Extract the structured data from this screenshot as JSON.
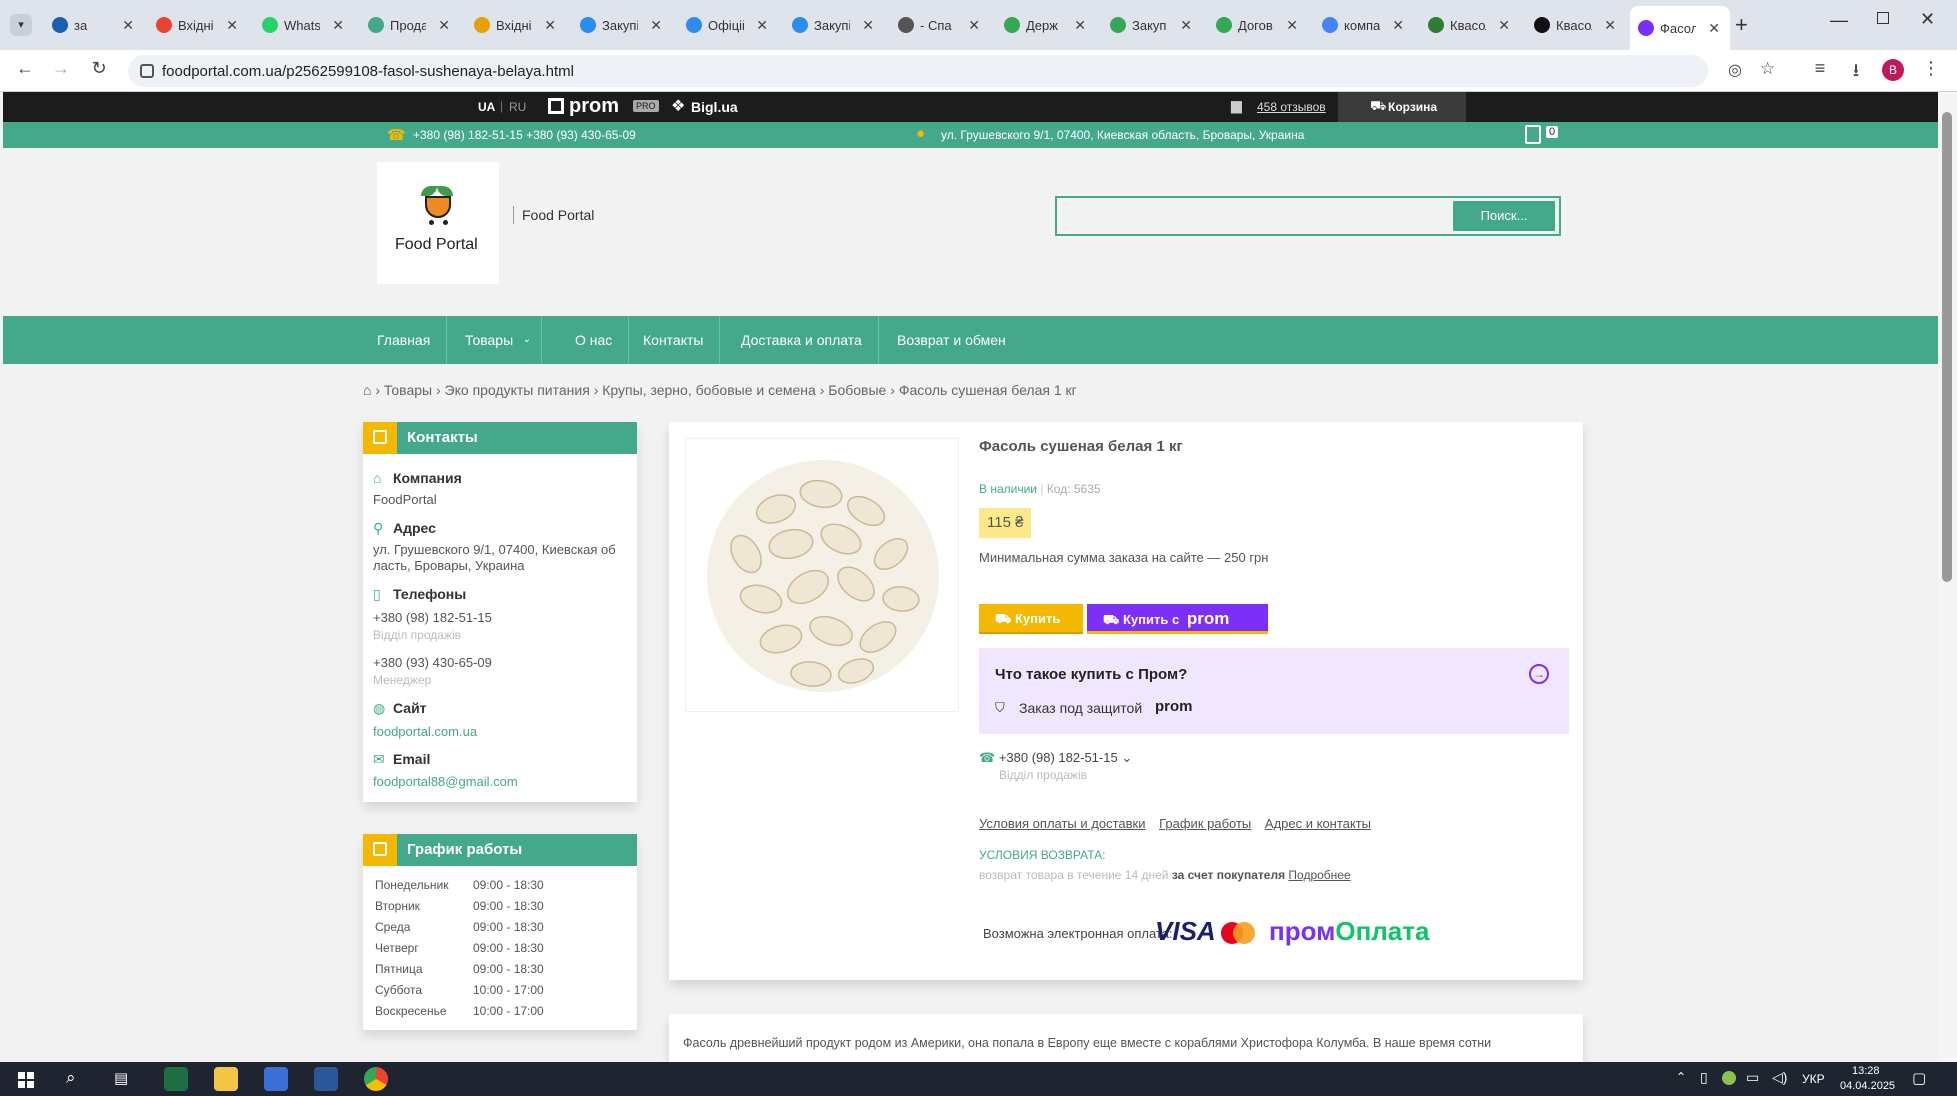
{
  "browser": {
    "tabs": [
      {
        "title": "за",
        "color": "#1a5fb4"
      },
      {
        "title": "Вхідні",
        "color": "#ea4335"
      },
      {
        "title": "WhatsApp",
        "color": "#25d366"
      },
      {
        "title": "Продаж",
        "color": "#44a98b"
      },
      {
        "title": "Вхідні",
        "color": "#e6a000"
      },
      {
        "title": "Закупівлі",
        "color": "#2d8cf0"
      },
      {
        "title": "Офіційно",
        "color": "#2d8cf0"
      },
      {
        "title": "Закупівлі",
        "color": "#2d8cf0"
      },
      {
        "title": "- Спа",
        "color": "#555"
      },
      {
        "title": "Держ",
        "color": "#34a853"
      },
      {
        "title": "Закуп",
        "color": "#34a853"
      },
      {
        "title": "Догов",
        "color": "#34a853"
      },
      {
        "title": "компа",
        "color": "#4285f4"
      },
      {
        "title": "Квасол",
        "color": "#2e7d32"
      },
      {
        "title": "Квасол",
        "color": "#111"
      },
      {
        "title": "Фасол",
        "color": "#7b2ff7"
      }
    ],
    "url": "foodportal.com.ua/p2562599108-fasol-sushenaya-belaya.html",
    "profile_initial": "B"
  },
  "topbar": {
    "lang_ua": "UA",
    "lang_ru": "RU",
    "prom_logo": "prom",
    "prom_badge": "PRO",
    "bigl": "Bigl.ua",
    "reviews": "458 отзывов",
    "cart": "Корзина"
  },
  "contacts_bar": {
    "phones": "+380 (98) 182-51-15   +380 (93) 430-65-09",
    "address": "ул. Грушевского 9/1, 07400, Киевская область, Бровары, Украина",
    "cart_count": "0"
  },
  "header": {
    "logo_text": "Food Portal",
    "company_name": "Food Portal",
    "search_placeholder": "",
    "search_button": "Поиск..."
  },
  "menu": {
    "items": [
      "Главная",
      "Товары",
      "О нас",
      "Контакты",
      "Доставка и оплата",
      "Возврат и обмен"
    ]
  },
  "breadcrumb": [
    "Товары",
    "Эко продукты питания",
    "Крупы, зерно, бобовые и семена",
    "Бобовые",
    "Фасоль сушеная белая 1 кг"
  ],
  "contacts_card": {
    "title": "Контакты",
    "company_label": "Компания",
    "company_value": "FoodPortal",
    "address_label": "Адрес",
    "address_line1": "ул. Грушевского 9/1, 07400, Киевская об",
    "address_line2": "ласть, Бровары, Украина",
    "phones_label": "Телефоны",
    "phone1": "+380 (98) 182-51-15",
    "phone1_note": "Відділ продажів",
    "phone2": "+380 (93) 430-65-09",
    "phone2_note": "Менеджер",
    "site_label": "Сайт",
    "site_value": "foodportal.com.ua",
    "email_label": "Email",
    "email_value": "foodportal88@gmail.com"
  },
  "schedule": {
    "title": "График работы",
    "days": [
      {
        "day": "Понедельник",
        "hours": "09:00 - 18:30"
      },
      {
        "day": "Вторник",
        "hours": "09:00 - 18:30"
      },
      {
        "day": "Среда",
        "hours": "09:00 - 18:30"
      },
      {
        "day": "Четверг",
        "hours": "09:00 - 18:30"
      },
      {
        "day": "Пятница",
        "hours": "09:00 - 18:30"
      },
      {
        "day": "Суббота",
        "hours": "10:00 - 17:00"
      },
      {
        "day": "Воскресенье",
        "hours": "10:00 - 17:00"
      }
    ]
  },
  "product": {
    "title": "Фасоль сушеная белая 1 кг",
    "availability": "В наличии",
    "code": "Код: 5635",
    "price": "115 ₴",
    "min_order": "Минимальная сумма заказа на сайте — 250 грн",
    "buy_button": "Купить",
    "buy_prom_button": "Купить с",
    "prom_box_title": "Что такое купить с Пром?",
    "prom_box_text": "Заказ под защитой",
    "phone": "+380 (98) 182-51-15",
    "phone_note": "Відділ продажів",
    "links": [
      "Условия оплаты и доставки",
      "График работы",
      "Адрес и контакты"
    ],
    "return_title": "УСЛОВИЯ ВОЗВРАТА:",
    "return_text": "возврат товара в течение 14 дней",
    "return_bold": "за счет покупателя",
    "return_more": "Подробнее",
    "payment_label": "Возможна электронная оплата:",
    "visa": "VISA",
    "prom_pay_a": "пром",
    "prom_pay_b": "Оплата"
  },
  "description": "Фасоль древнейший продукт родом из Америки, она попала в Европу еще вместе с кораблями Христофора Колумба. В наше время сотни",
  "taskbar": {
    "lang": "УКР",
    "time": "13:28",
    "date": "04.04.2025"
  },
  "colors": {
    "brand_green": "#44a98b",
    "buy_yellow": "#f5b800",
    "prom_purple": "#7b2ff7"
  }
}
